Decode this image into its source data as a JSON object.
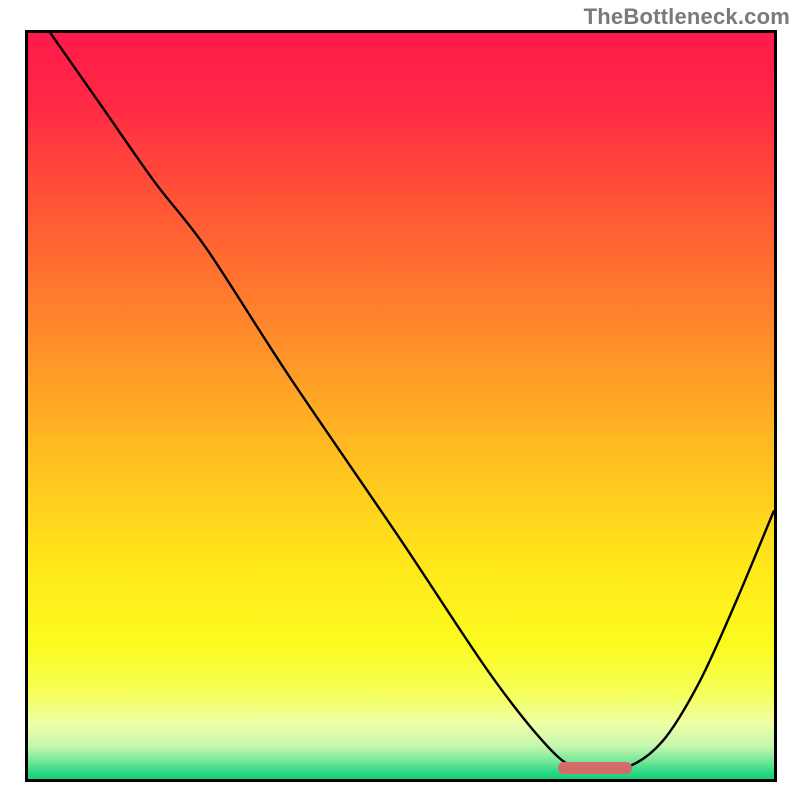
{
  "watermark": "TheBottleneck.com",
  "colors": {
    "gradient_stops": [
      {
        "offset": 0.0,
        "color": "#ff1a4b"
      },
      {
        "offset": 0.1,
        "color": "#ff2a44"
      },
      {
        "offset": 0.22,
        "color": "#ff5236"
      },
      {
        "offset": 0.35,
        "color": "#ff7a2e"
      },
      {
        "offset": 0.48,
        "color": "#ffa326"
      },
      {
        "offset": 0.6,
        "color": "#ffc81f"
      },
      {
        "offset": 0.72,
        "color": "#ffe91a"
      },
      {
        "offset": 0.82,
        "color": "#fbfb1f"
      },
      {
        "offset": 0.885,
        "color": "#f6ff5a"
      },
      {
        "offset": 0.925,
        "color": "#f0ffa6"
      },
      {
        "offset": 0.955,
        "color": "#c7f7af"
      },
      {
        "offset": 0.975,
        "color": "#7be89a"
      },
      {
        "offset": 0.99,
        "color": "#30d985"
      },
      {
        "offset": 1.0,
        "color": "#16cf79"
      }
    ],
    "curve": "#000000",
    "marker": "#d46a6a"
  },
  "chart_data": {
    "type": "line",
    "title": "",
    "xlabel": "",
    "ylabel": "",
    "xlim": [
      0,
      100
    ],
    "ylim": [
      0,
      100
    ],
    "series": [
      {
        "name": "bottleneck-curve",
        "x": [
          3.0,
          10.0,
          17.0,
          24.0,
          35.0,
          50.0,
          62.0,
          70.0,
          74.0,
          80.0,
          85.0,
          90.0,
          95.0,
          100.0
        ],
        "y": [
          100.0,
          90.0,
          80.0,
          71.0,
          54.0,
          32.0,
          14.0,
          4.0,
          1.5,
          1.5,
          5.0,
          13.0,
          24.0,
          36.0
        ]
      }
    ],
    "marker": {
      "x_start": 71.0,
      "x_end": 81.0,
      "y": 1.5,
      "thickness_pct": 1.6
    }
  }
}
